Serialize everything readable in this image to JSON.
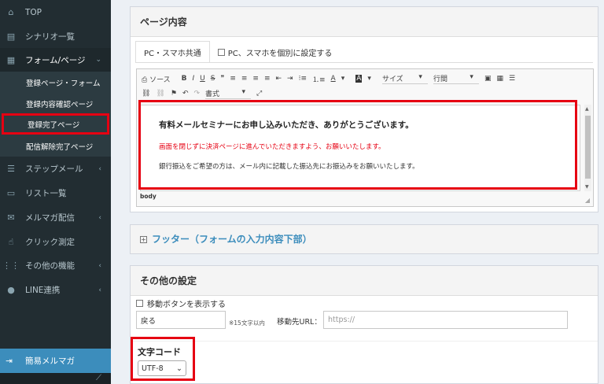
{
  "sidebar": {
    "items": [
      {
        "label": "TOP",
        "icon": "home-icon",
        "glyph": "⌂"
      },
      {
        "label": "シナリオ一覧",
        "icon": "list-icon",
        "glyph": "▤"
      },
      {
        "label": "フォーム/ページ",
        "icon": "form-icon",
        "glyph": "▦"
      },
      {
        "label": "ステップメール",
        "icon": "steps-icon",
        "glyph": "☰"
      },
      {
        "label": "リスト一覧",
        "icon": "document-icon",
        "glyph": "▭"
      },
      {
        "label": "メルマガ配信",
        "icon": "envelope-icon",
        "glyph": "✉"
      },
      {
        "label": "クリック測定",
        "icon": "pointer-icon",
        "glyph": "☝"
      },
      {
        "label": "その他の機能",
        "icon": "grid-icon",
        "glyph": "⋮⋮"
      },
      {
        "label": "LINE連携",
        "icon": "chat-icon",
        "glyph": "●"
      }
    ],
    "submenu": [
      {
        "label": "登録ページ・フォーム"
      },
      {
        "label": "登録内容確認ページ"
      },
      {
        "label": "登録完了ページ"
      },
      {
        "label": "配信解除完了ページ"
      }
    ],
    "bottom": {
      "label": "簡易メルマガ",
      "icon": "sign-in-icon",
      "glyph": "⇥"
    },
    "toggle_glyph": "⟋",
    "chevron_left": "‹",
    "chevron_down": "⌄"
  },
  "page_content": {
    "title": "ページ内容",
    "tabs": [
      {
        "label": "PC・スマホ共通"
      },
      {
        "label": "PC、スマホを個別に設定する"
      }
    ],
    "toolbar": {
      "source_label": "ソース",
      "bold": "B",
      "italic": "I",
      "underline": "U",
      "strike": "S",
      "quote": "❞",
      "size_label": "サイズ",
      "format_label": "書式",
      "spacing_label": "行間",
      "font_color": "A",
      "bg_color": "A",
      "align_left": "≡",
      "align_center": "≡",
      "align_right": "≡",
      "align_justify": "≡",
      "outdent": "⇤",
      "indent": "⇥",
      "ul": "⁝≡",
      "ol": "⒈≡",
      "image": "▣",
      "table": "▦",
      "hr": "☰",
      "link": "⛓",
      "unlink": "⛓",
      "anchor": "⚑",
      "undo": "↶",
      "redo": "↷",
      "maximize": "⤢",
      "dropdown_caret": "▾"
    },
    "editor": {
      "heading": "有料メールセミナーにお申し込みいただき、ありがとうございます。",
      "red_text": "画面を閉じずに決済ページに進んでいただきますよう、お願いいたします。",
      "note": "銀行振込をご希望の方は、メール内に記載した振込先にお振込みをお願いいたします。",
      "status": "body",
      "scroll_up": "▲",
      "scroll_down": "▼",
      "resize_glyph": "◢"
    }
  },
  "footer_section": {
    "title": "フッター（フォームの入力内容下部）",
    "plus": "+"
  },
  "other_settings": {
    "title": "その他の設定",
    "move_button_label": "移動ボタンを表示する",
    "button_text_value": "戻る",
    "char_limit_note": "※15文字以内",
    "url_label": "移動先URL：",
    "url_placeholder": "https://",
    "char_code_label": "文字コード",
    "char_code_value": "UTF-8",
    "char_code_caret": "⌄"
  },
  "colors": {
    "sidebar_bg": "#222d32",
    "accent": "#3c8dbc",
    "highlight_red": "#e60012"
  }
}
